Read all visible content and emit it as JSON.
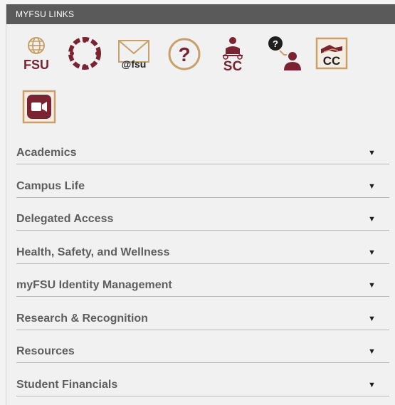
{
  "header": {
    "title": "MYFSU LINKS"
  },
  "icons": [
    {
      "name": "globe-fsu-icon",
      "label": "FSU"
    },
    {
      "name": "canvas-icon"
    },
    {
      "name": "fsu-mail-icon",
      "label": "@fsu"
    },
    {
      "name": "help-question-icon",
      "label": "?"
    },
    {
      "name": "student-central-icon",
      "label": "SC"
    },
    {
      "name": "help-person-icon"
    },
    {
      "name": "career-center-icon",
      "label": "CC"
    },
    {
      "name": "zoom-video-icon"
    }
  ],
  "sections": [
    {
      "label": "Academics"
    },
    {
      "label": "Campus Life"
    },
    {
      "label": "Delegated Access"
    },
    {
      "label": "Health, Safety, and Wellness"
    },
    {
      "label": "myFSU Identity Management"
    },
    {
      "label": "Research & Recognition"
    },
    {
      "label": "Resources"
    },
    {
      "label": "Student Financials"
    }
  ],
  "colors": {
    "garnet": "#7a2433",
    "gold": "#c9a06a",
    "header": "#5a5a5a"
  }
}
